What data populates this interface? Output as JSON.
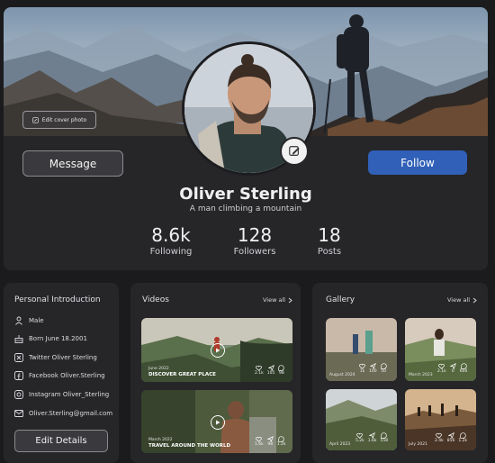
{
  "profile": {
    "edit_cover_label": "Edit cover photo",
    "name": "Oliver Sterling",
    "subtitle": "A man climbing a mountain",
    "message_label": "Message",
    "follow_label": "Follow",
    "stats": [
      {
        "value": "8.6k",
        "label": "Following"
      },
      {
        "value": "128",
        "label": "Followers"
      },
      {
        "value": "18",
        "label": "Posts"
      }
    ]
  },
  "intro": {
    "title": "Personal Introduction",
    "items": [
      {
        "icon": "user-icon",
        "text": "Male"
      },
      {
        "icon": "cake-icon",
        "text": "Born June 18.2001"
      },
      {
        "icon": "twitter-icon",
        "text": "Twitter Oliver Sterling"
      },
      {
        "icon": "facebook-icon",
        "text": "Facebook Oliver.Sterling"
      },
      {
        "icon": "instagram-icon",
        "text": "Instagram Oliver_Sterling"
      },
      {
        "icon": "mail-icon",
        "text": "Oliver.Sterling@gmail.com"
      }
    ],
    "edit_label": "Edit Details"
  },
  "videos": {
    "title": "Videos",
    "view_all": "View all",
    "items": [
      {
        "date": "June 2022",
        "title": "DISCOVER GREAT PLACE",
        "likes": "2.1k",
        "shares": "105",
        "comments": "98"
      },
      {
        "date": "March 2022",
        "title": "TRAVEL AROUND THE WORLD",
        "likes": "1.6k",
        "shares": "98",
        "comments": "1.2k"
      }
    ]
  },
  "gallery": {
    "title": "Gallery",
    "view_all": "View all",
    "items": [
      {
        "date": "August 2024",
        "likes": "1k",
        "shares": "100",
        "comments": "50"
      },
      {
        "date": "March 2023",
        "likes": "2.1k",
        "shares": "0",
        "comments": "600"
      },
      {
        "date": "April 2023",
        "likes": "5.2k",
        "shares": "1.6k",
        "comments": "558"
      },
      {
        "date": "July 2021",
        "likes": "2.4k",
        "shares": "856",
        "comments": "1.2k"
      }
    ]
  },
  "colors": {
    "accent": "#3060b8",
    "panel": "#262629",
    "background": "#1b1b1d"
  }
}
